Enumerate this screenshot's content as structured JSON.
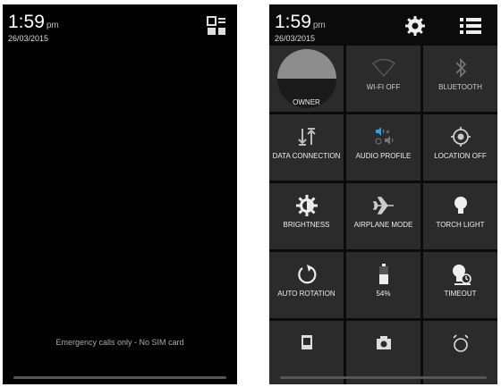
{
  "lock_screen": {
    "time": "1:59",
    "ampm": "pm",
    "date": "26/03/2015",
    "emergency_text": "Emergency calls only - No SIM card",
    "notification_icon": "notification-list-icon"
  },
  "quick_settings": {
    "time": "1:59",
    "ampm": "pm",
    "date": "26/03/2015",
    "header_icons": [
      "gear-icon",
      "menu-list-icon"
    ],
    "tiles": [
      {
        "label": "OWNER",
        "icon": "user-avatar"
      },
      {
        "label": "WI-FI OFF",
        "icon": "wifi-icon"
      },
      {
        "label": "BLUETOOTH",
        "icon": "bluetooth-icon"
      },
      {
        "label": "DATA CONNECTION",
        "icon": "data-transfer-icon"
      },
      {
        "label": "AUDIO PROFILE",
        "icon": "audio-profile-icon"
      },
      {
        "label": "LOCATION OFF",
        "icon": "location-icon"
      },
      {
        "label": "BRIGHTNESS",
        "icon": "brightness-icon"
      },
      {
        "label": "AIRPLANE MODE",
        "icon": "airplane-icon"
      },
      {
        "label": "TORCH LIGHT",
        "icon": "torch-icon"
      },
      {
        "label": "AUTO ROTATION",
        "icon": "rotation-icon"
      },
      {
        "label": "54%",
        "icon": "battery-icon"
      },
      {
        "label": "TIMEOUT",
        "icon": "timeout-icon"
      }
    ],
    "partial_row_icons": [
      "screenshot-icon",
      "camera-icon",
      "alarm-icon"
    ]
  }
}
